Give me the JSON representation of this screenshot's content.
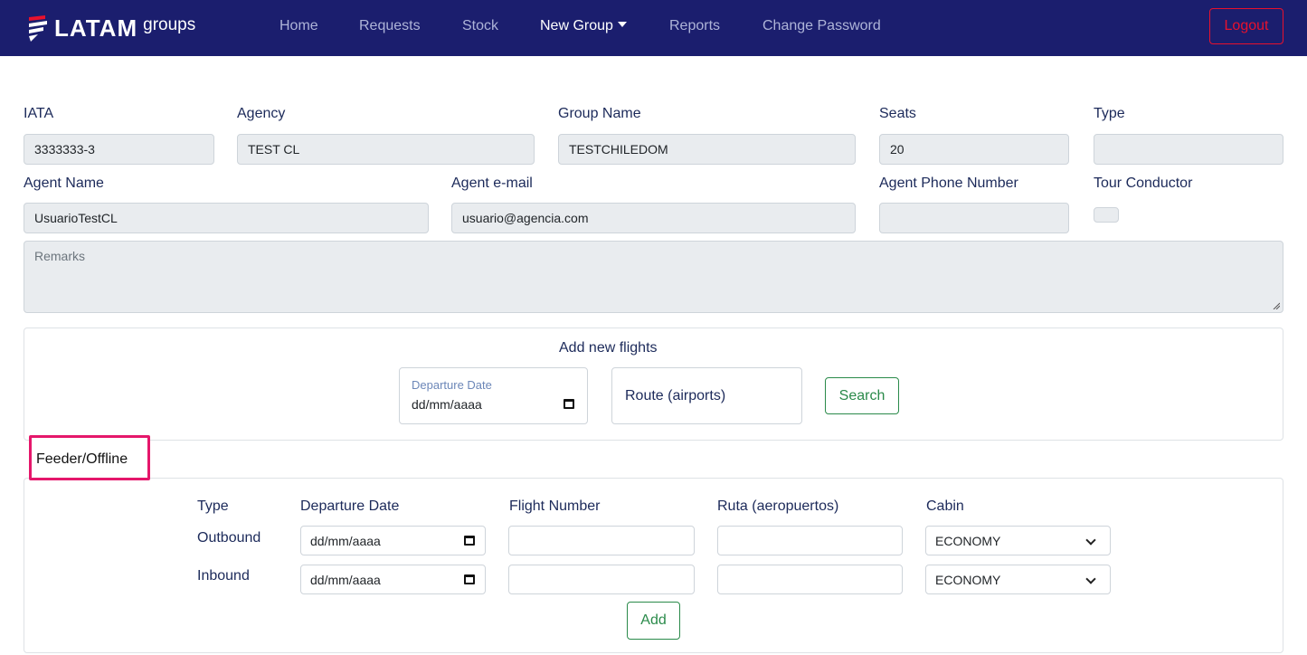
{
  "nav": {
    "brand_latam": "LATAM",
    "brand_groups": "groups",
    "items": [
      "Home",
      "Requests",
      "Stock",
      "New Group",
      "Reports",
      "Change Password"
    ],
    "logout": "Logout"
  },
  "form": {
    "iata_label": "IATA",
    "iata_value": "3333333-3",
    "agency_label": "Agency",
    "agency_value": "TEST CL",
    "group_name_label": "Group Name",
    "group_name_value": "TESTCHILEDOM",
    "seats_label": "Seats",
    "seats_value": "20",
    "type_label": "Type",
    "type_value": "",
    "agent_name_label": "Agent Name",
    "agent_name_value": "UsuarioTestCL",
    "agent_email_label": "Agent e-mail",
    "agent_email_value": "usuario@agencia.com",
    "agent_phone_label": "Agent Phone Number",
    "agent_phone_value": "",
    "tour_conductor_label": "Tour Conductor",
    "remarks_placeholder": "Remarks"
  },
  "add_flights": {
    "title": "Add new flights",
    "departure_date_label": "Departure Date",
    "departure_date_value": "dd/mm/aaaa",
    "route_placeholder": "Route (airports)",
    "search_button": "Search"
  },
  "feeder": {
    "title": "Feeder/Offline",
    "col_type": "Type",
    "col_departure": "Departure Date",
    "col_flight": "Flight Number",
    "col_route": "Ruta (aeropuertos)",
    "col_cabin": "Cabin",
    "rows": [
      {
        "type": "Outbound",
        "date": "dd/mm/aaaa",
        "flight": "",
        "route": "",
        "cabin": "ECONOMY"
      },
      {
        "type": "Inbound",
        "date": "dd/mm/aaaa",
        "flight": "",
        "route": "",
        "cabin": "ECONOMY"
      }
    ],
    "add_button": "Add"
  },
  "colors": {
    "navbar": "#1b1e6e",
    "logout": "#e8112d",
    "success": "#2a8a4a",
    "highlight": "#e5176b"
  }
}
